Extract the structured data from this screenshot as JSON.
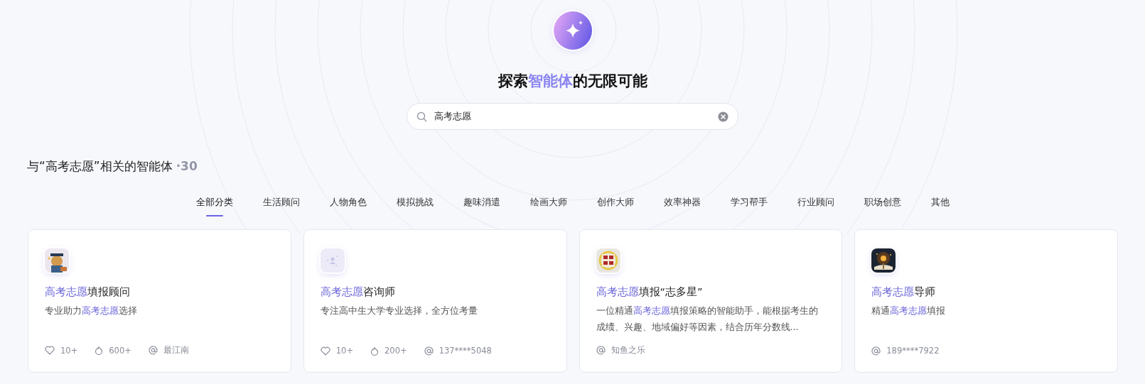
{
  "hero": {
    "heading": [
      {
        "text": "探索",
        "highlight": false
      },
      {
        "text": "智能体",
        "highlight": true
      },
      {
        "text": "的无限可能",
        "highlight": false
      }
    ]
  },
  "search": {
    "value": "高考志愿"
  },
  "results": {
    "title": "与“高考志愿”相关的智能体",
    "count": "·30"
  },
  "tabs": [
    {
      "label": "全部分类",
      "selected": true
    },
    {
      "label": "生活顾问",
      "selected": false
    },
    {
      "label": "人物角色",
      "selected": false
    },
    {
      "label": "模拟挑战",
      "selected": false
    },
    {
      "label": "趣味消遣",
      "selected": false
    },
    {
      "label": "绘画大师",
      "selected": false
    },
    {
      "label": "创作大师",
      "selected": false
    },
    {
      "label": "效率神器",
      "selected": false
    },
    {
      "label": "学习帮手",
      "selected": false
    },
    {
      "label": "行业顾问",
      "selected": false
    },
    {
      "label": "职场创意",
      "selected": false
    },
    {
      "label": "其他",
      "selected": false
    }
  ],
  "cards": [
    {
      "avatar": {
        "kind": "picture"
      },
      "title": [
        {
          "text": "高考志愿",
          "highlight": true
        },
        {
          "text": "填报顾问",
          "highlight": false
        }
      ],
      "description": [
        {
          "text": "专业助力",
          "highlight": false
        },
        {
          "text": "高考志愿",
          "highlight": true
        },
        {
          "text": "选择",
          "highlight": false
        }
      ],
      "stats": [
        {
          "kind": "likes",
          "text": "10+"
        },
        {
          "kind": "uses",
          "text": "600+"
        },
        {
          "kind": "author",
          "text": "最江南"
        }
      ]
    },
    {
      "avatar": {
        "kind": "placeholder"
      },
      "title": [
        {
          "text": "高考志愿",
          "highlight": true
        },
        {
          "text": "咨询师",
          "highlight": false
        }
      ],
      "description": [
        {
          "text": "专注高中生大学专业选择，全方位考量",
          "highlight": false
        }
      ],
      "stats": [
        {
          "kind": "likes",
          "text": "10+"
        },
        {
          "kind": "uses",
          "text": "200+"
        },
        {
          "kind": "author",
          "text": "137****5048"
        }
      ]
    },
    {
      "avatar": {
        "kind": "picture"
      },
      "title": [
        {
          "text": "高考志愿",
          "highlight": true
        },
        {
          "text": "填报“志多星”",
          "highlight": false
        }
      ],
      "description": [
        {
          "text": "一位精通",
          "highlight": false
        },
        {
          "text": "高考志愿",
          "highlight": true
        },
        {
          "text": "填报策略的智能助手，能根据考生的成绩、兴趣、地域偏好等因素，结合历年分数线...",
          "highlight": false
        }
      ],
      "stats": [
        {
          "kind": "author",
          "text": "知鱼之乐"
        }
      ]
    },
    {
      "avatar": {
        "kind": "picture"
      },
      "title": [
        {
          "text": "高考志愿",
          "highlight": true
        },
        {
          "text": "导师",
          "highlight": false
        }
      ],
      "description": [
        {
          "text": "精通",
          "highlight": false
        },
        {
          "text": "高考志愿",
          "highlight": true
        },
        {
          "text": "填报",
          "highlight": false
        }
      ],
      "stats": [
        {
          "kind": "author",
          "text": "189****7922"
        }
      ]
    }
  ]
}
